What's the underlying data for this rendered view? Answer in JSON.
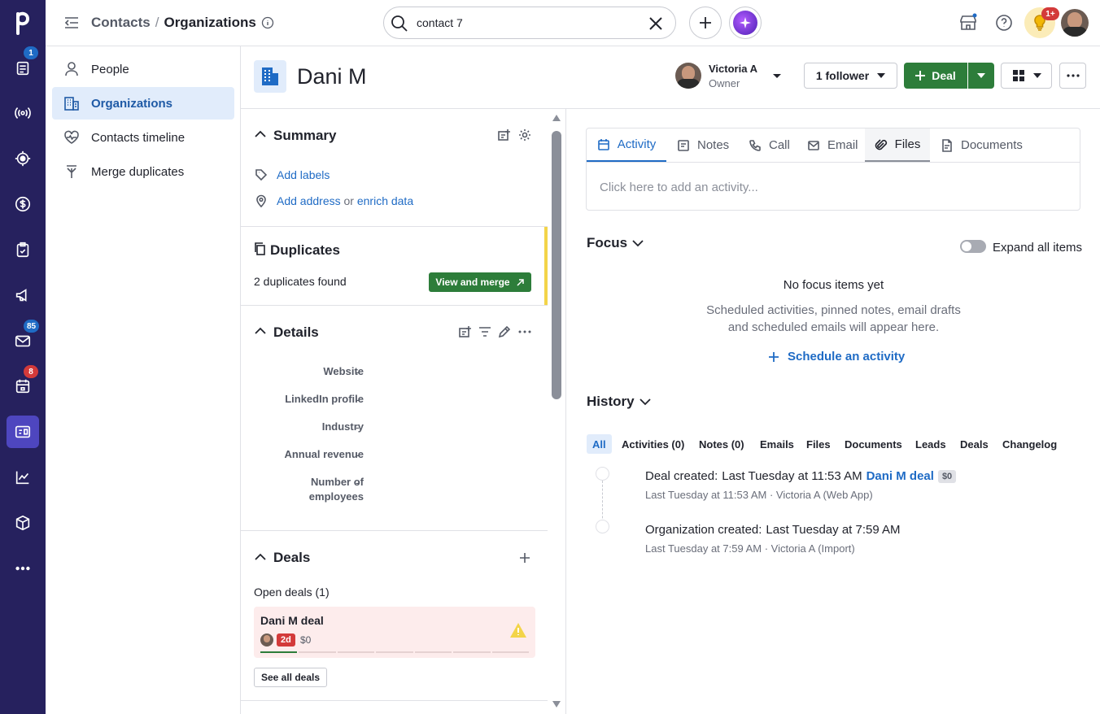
{
  "rail": {
    "items": [
      {
        "icon": "pipedrive-logo-icon"
      },
      {
        "icon": "leads-inbox-icon",
        "badge": "1"
      },
      {
        "icon": "broadcast-icon"
      },
      {
        "icon": "target-icon"
      },
      {
        "icon": "deals-dollar-icon"
      },
      {
        "icon": "tasks-clipboard-icon"
      },
      {
        "icon": "campaigns-megaphone-icon"
      },
      {
        "icon": "mail-icon",
        "badge": "85"
      },
      {
        "icon": "calendar-icon",
        "badge": "8"
      },
      {
        "icon": "contacts-card-icon"
      },
      {
        "icon": "insights-chart-icon"
      },
      {
        "icon": "products-box-icon"
      },
      {
        "icon": "more-icon"
      }
    ],
    "badge_colors": {
      "leads": "#1f6bc5",
      "mail": "#1f6bc5",
      "calendar": "#d33a3a"
    }
  },
  "topbar": {
    "breadcrumb_parent": "Contacts",
    "breadcrumb_sep": "/",
    "breadcrumb_current": "Organizations",
    "search_value": "contact 7",
    "notification_badge": "1+"
  },
  "sidenav": {
    "items": [
      {
        "label": "People"
      },
      {
        "label": "Organizations"
      },
      {
        "label": "Contacts timeline"
      },
      {
        "label": "Merge duplicates"
      }
    ]
  },
  "header": {
    "org_name": "Dani M",
    "owner_name": "Victoria A",
    "owner_role": "Owner",
    "follower_label": "1 follower",
    "deal_button": "Deal"
  },
  "summary": {
    "title": "Summary",
    "add_labels": "Add labels",
    "add_address": "Add address",
    "or_text": "or",
    "enrich_data": "enrich data"
  },
  "duplicates": {
    "title": "Duplicates",
    "found_text": "2 duplicates found",
    "merge_button": "View and merge"
  },
  "details": {
    "title": "Details",
    "fields": [
      {
        "label": "Website",
        "value": "-"
      },
      {
        "label": "LinkedIn profile",
        "value": "-"
      },
      {
        "label": "Industry",
        "value": "-"
      },
      {
        "label": "Annual revenue",
        "value": "-"
      },
      {
        "label_line1": "Number of",
        "label_line2": "employees",
        "value": "-"
      }
    ]
  },
  "deals": {
    "title": "Deals",
    "open_deals": "Open deals (1)",
    "deal_name": "Dani M deal",
    "deal_age": "2d",
    "deal_value": "$0",
    "see_all": "See all deals"
  },
  "activity_tabs": {
    "tabs": [
      {
        "label": "Activity"
      },
      {
        "label": "Notes"
      },
      {
        "label": "Call"
      },
      {
        "label": "Email"
      },
      {
        "label": "Files"
      },
      {
        "label": "Documents"
      }
    ],
    "placeholder": "Click here to add an activity..."
  },
  "focus": {
    "title": "Focus",
    "expand_label": "Expand all items",
    "empty_title": "No focus items yet",
    "empty_line1": "Scheduled activities, pinned notes, email drafts",
    "empty_line2": "and scheduled emails will appear here.",
    "schedule_link": "Schedule an activity"
  },
  "history": {
    "title": "History",
    "filters": [
      {
        "label": "All"
      },
      {
        "label": "Activities (0)"
      },
      {
        "label": "Notes (0)"
      },
      {
        "label": "Emails"
      },
      {
        "label": "Files"
      },
      {
        "label": "Documents"
      },
      {
        "label": "Leads"
      },
      {
        "label": "Deals"
      },
      {
        "label": "Changelog"
      }
    ],
    "events": [
      {
        "title": "Deal created",
        "when": "Last Tuesday at 11:53 AM",
        "link": "Dani M deal",
        "badge": "$0",
        "meta": "Last Tuesday at 11:53 AM · Victoria A (Web App)"
      },
      {
        "title": "Organization created",
        "when": "Last Tuesday at 7:59 AM",
        "meta": "Last Tuesday at 7:59 AM · Victoria A (Import)"
      }
    ]
  },
  "colors": {
    "rail_bg": "#26215e",
    "accent_blue": "#1f6bc5",
    "deal_green": "#2d7d3a",
    "warning_yellow": "#f3d449"
  }
}
